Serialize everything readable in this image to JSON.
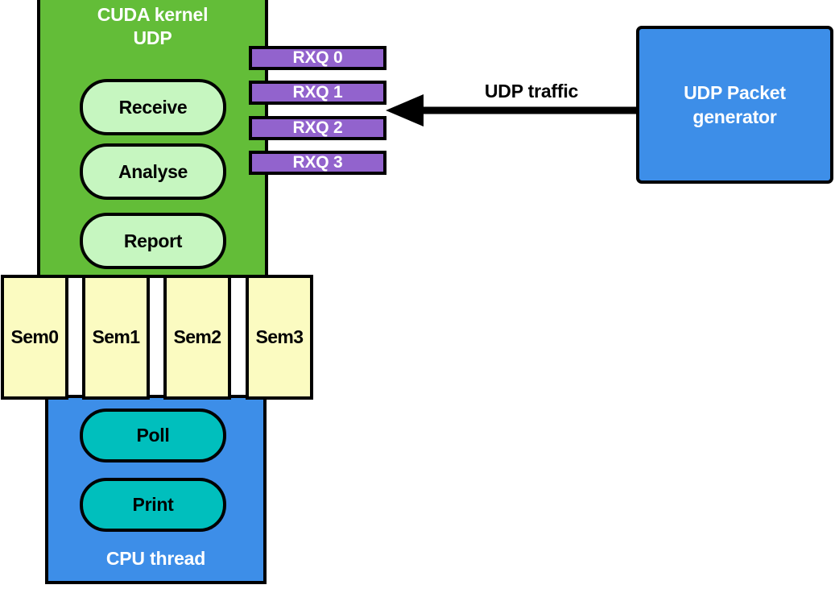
{
  "diagram": {
    "cuda_kernel": {
      "title_line1": "CUDA kernel",
      "title_line2": "UDP",
      "fill_color": "#63bd38",
      "stages": [
        {
          "label": "Receive"
        },
        {
          "label": "Analyse"
        },
        {
          "label": "Report"
        }
      ],
      "stage_fill_color": "#c6f6c0"
    },
    "rx_queues": {
      "fill_color": "#9263cd",
      "items": [
        {
          "label": "RXQ 0"
        },
        {
          "label": "RXQ 1"
        },
        {
          "label": "RXQ 2"
        },
        {
          "label": "RXQ 3"
        }
      ]
    },
    "semaphores": {
      "fill_color": "#fbfbc1",
      "items": [
        {
          "label": "Sem0"
        },
        {
          "label": "Sem1"
        },
        {
          "label": "Sem2"
        },
        {
          "label": "Sem3"
        }
      ]
    },
    "cpu_thread": {
      "title": "CPU thread",
      "fill_color": "#3d8ee8",
      "nodes": [
        {
          "label": "Poll"
        },
        {
          "label": "Print"
        }
      ],
      "node_fill_color": "#00bfbd"
    },
    "generator": {
      "line1": "UDP Packet",
      "line2": "generator",
      "fill_color": "#3d8ee8"
    },
    "connection": {
      "label": "UDP traffic",
      "color": "#000000",
      "direction": "right-to-left"
    }
  }
}
